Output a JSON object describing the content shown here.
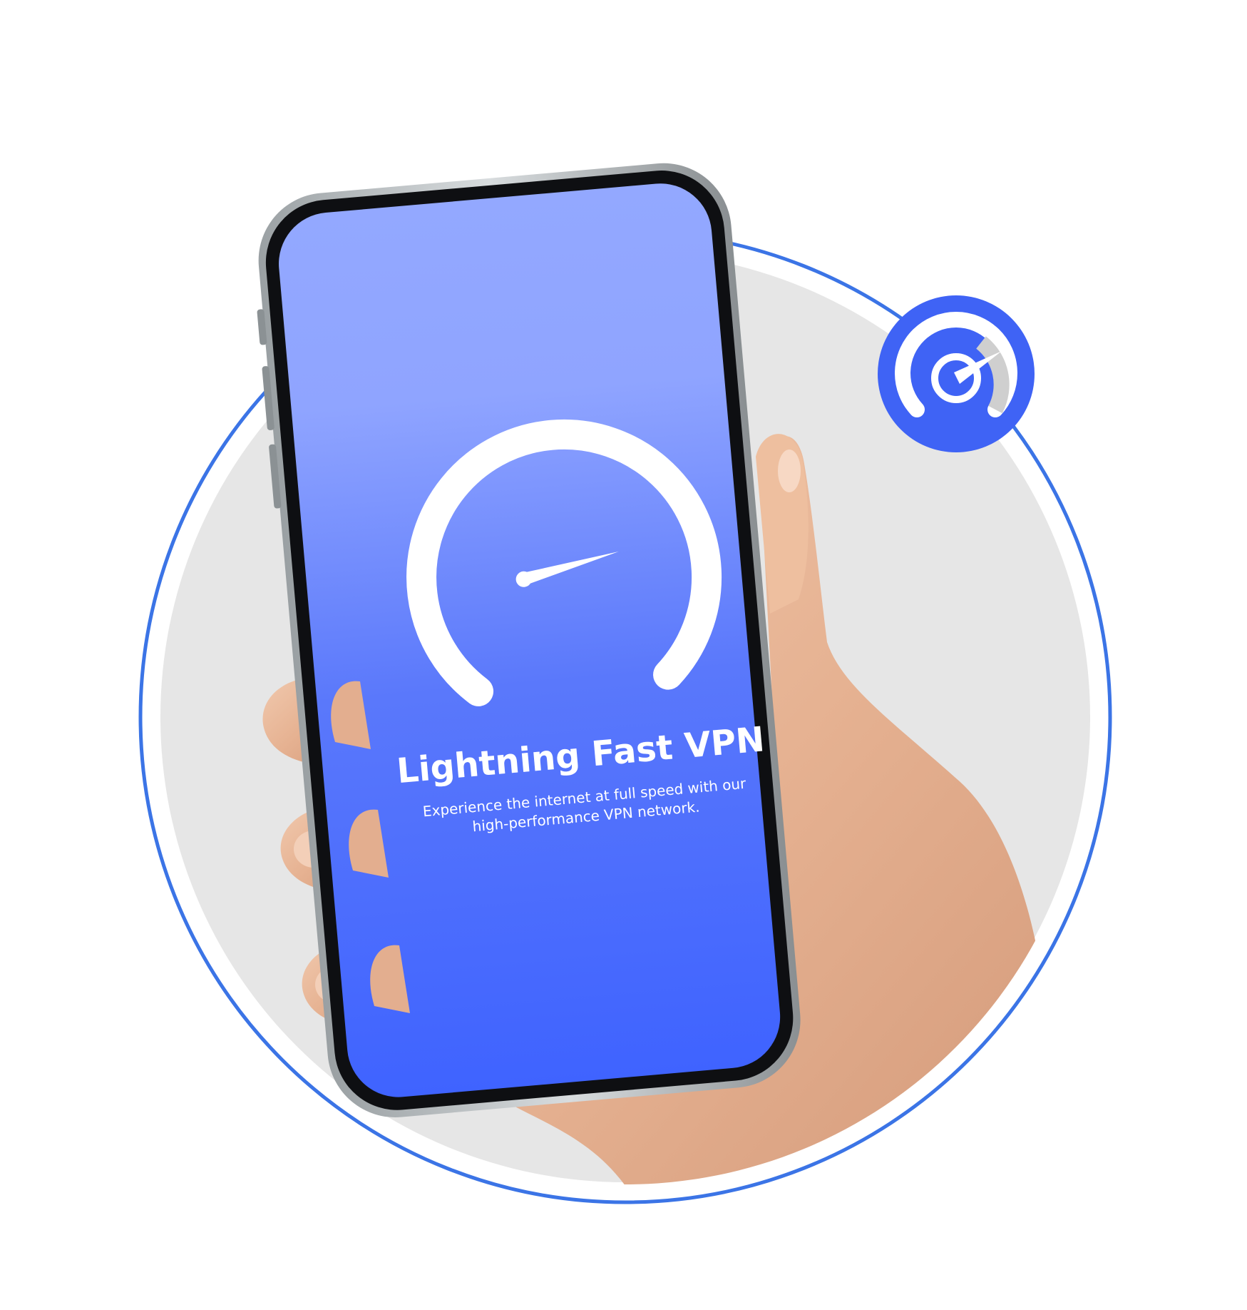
{
  "screen": {
    "title": "Lightning Fast VPN",
    "subtitle_line1": "Experience the internet at full speed with our",
    "subtitle_line2": "high-performance VPN network."
  },
  "colors": {
    "accent_blue": "#3f63f5",
    "ring_blue": "#3b74e6",
    "backdrop_gray": "#e6e6e6",
    "screen_top": "#93a8ff",
    "screen_bottom": "#3f63ff",
    "skin": "#e8b89a"
  },
  "icons": {
    "phone_gauge": "speedometer-icon",
    "badge": "speedometer-badge-icon"
  }
}
